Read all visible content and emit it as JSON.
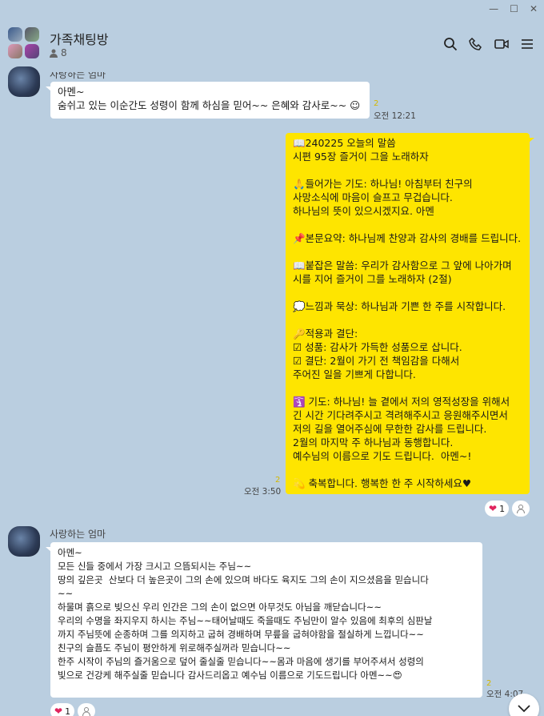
{
  "window": {
    "min": "—",
    "max": "☐",
    "close": "✕"
  },
  "header": {
    "title": "가족채팅방",
    "member_count": "8"
  },
  "messages": [
    {
      "sender": "사랑하는 엄마",
      "text": "아멘~\n숨쉬고 있는 이순간도 성령이 함께 하심을 믿어~~ 은혜와 감사로~~ ☺",
      "unread": "2",
      "time": "오전 12:21"
    },
    {
      "text": "📖240225 오늘의 말씀\n시편 95장 즐거이 그을 노래하자\n\n🙏들어가는 기도: 하나님! 아침부터 친구의\n사망소식에 마음이 슬프고 무겁습니다.\n하나님의 뜻이 있으시겠지요. 아멘\n\n📌본문요약: 하나님께 찬양과 감사의 경배를 드립니다.\n\n📖붙잡은 말씀: 우리가 감사함으로 그 앞에 나아가며\n시를 지어 즐거이 그를 노래하자 (2절)\n\n💭느낌과 묵상: 하나님과 기쁜 한 주를 시작합니다.\n\n🔑적용과 결단:\n☑ 성품: 감사가 가득한 성품으로 삽니다.\n☑ 결단: 2월이 가기 전 책임감을 다해서\n주어진 일을 기쁘게 다합니다.\n\n🛐 기도: 하나님! 늘 곁에서 저의 영적성장을 위해서\n긴 시간 기다려주시고 격려해주시고 응원해주시면서\n저의 길을 열어주심에 무한한 감사를 드립니다.\n2월의 마지막 주 하나님과 동행합니다.\n예수님의 이름으로 기도 드립니다.  아멘~!\n\n💫 축복합니다. 행복한 한 주 시작하세요♥",
      "unread": "2",
      "time": "오전 3:50",
      "reaction_count": "1"
    },
    {
      "sender": "사랑하는 엄마",
      "text": "아멘~\n모든 신들 중에서 가장 크시고 으뜸되시는 주님~~\n땅의 깊은곳  산보다 더 높은곳이 그의 손에 있으며 바다도 육지도 그의 손이 지으셨음을 믿습니다\n~~\n하물며 흙으로 빚으신 우리 인간은 그의 손이 없으면 아무것도 아님을 깨닫습니다~~\n우리의 수명을 좌지우지 하시는 주님~~태어날때도 죽을때도 주님만이 알수 있음에 최후의 심판날\n까지 주님뜻에 순종하며 그를 의지하고 굽혀 경배하며 무릎을 굽혀야함을 절실하게 느낍니다~~\n친구의 슬픔도 주님이 평안하게 위로해주실꺼라 믿습니다~~\n한주 시작이 주님의 즐거움으로 덮어 줄실줄 믿습니다~~몸과 마음에 생기를 부어주셔서 성령의\n빛으로 건강케 해주실줄 믿습니다 감사드리옵고 예수님 이름으로 기도드립니다 아멘~~😍",
      "unread": "2",
      "time": "오전 4:07",
      "reaction_count": "1"
    }
  ],
  "colors": {
    "bg": "#bacee0",
    "out_bubble": "#fee500",
    "heart": "#e0245e"
  }
}
